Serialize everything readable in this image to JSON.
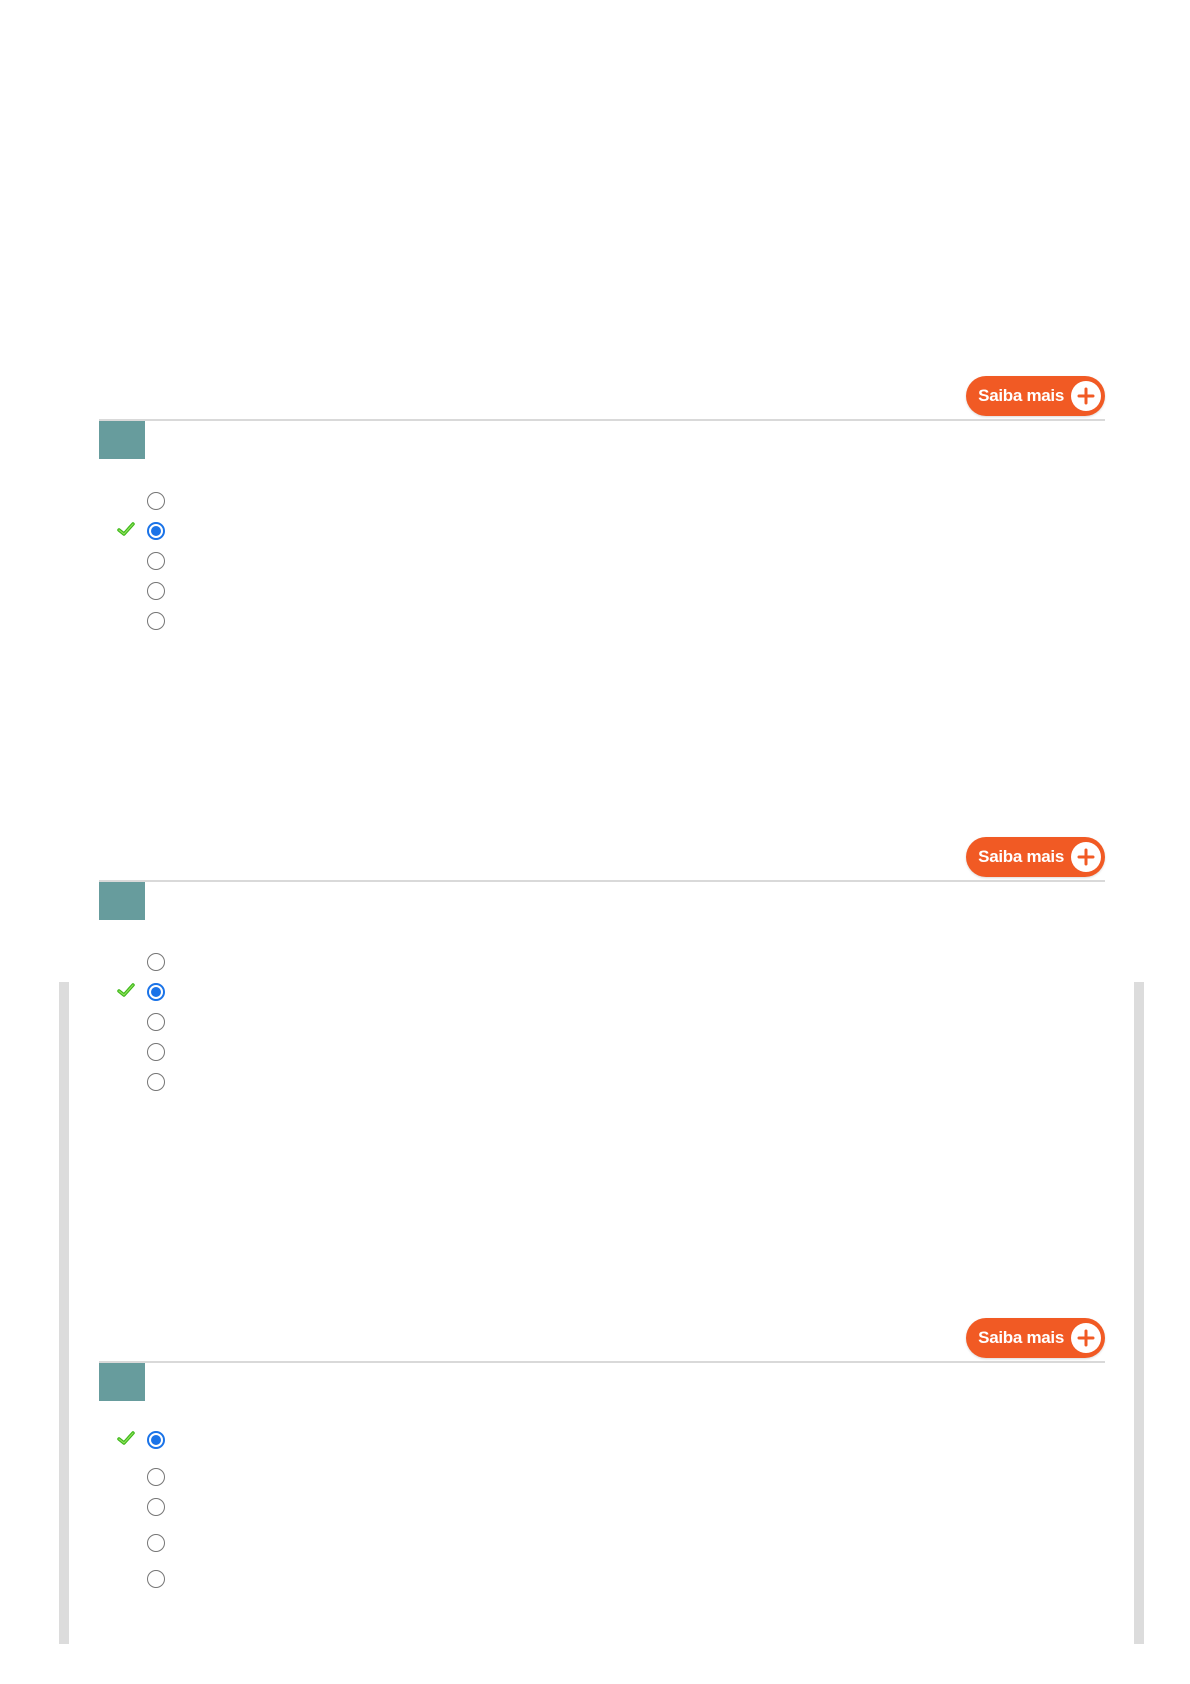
{
  "colors": {
    "accent_orange": "#f15a24",
    "question_badge": "#679c9d",
    "radio_selected": "#1a73e8",
    "correct_check": "#3db81a",
    "side_bar": "#dcdcdc"
  },
  "questions": [
    {
      "saiba_mais_label": "Saiba mais",
      "number": "",
      "options": [
        {
          "text": "",
          "selected": false,
          "correct": false
        },
        {
          "text": "",
          "selected": true,
          "correct": true
        },
        {
          "text": "",
          "selected": false,
          "correct": false
        },
        {
          "text": "",
          "selected": false,
          "correct": false
        },
        {
          "text": "",
          "selected": false,
          "correct": false
        }
      ]
    },
    {
      "saiba_mais_label": "Saiba mais",
      "number": "",
      "options": [
        {
          "text": "",
          "selected": false,
          "correct": false
        },
        {
          "text": "",
          "selected": true,
          "correct": true
        },
        {
          "text": "",
          "selected": false,
          "correct": false
        },
        {
          "text": "",
          "selected": false,
          "correct": false
        },
        {
          "text": "",
          "selected": false,
          "correct": false
        }
      ]
    },
    {
      "saiba_mais_label": "Saiba mais",
      "number": "",
      "options": [
        {
          "text": "",
          "selected": true,
          "correct": true
        },
        {
          "text": "",
          "selected": false,
          "correct": false
        },
        {
          "text": "",
          "selected": false,
          "correct": false
        },
        {
          "text": "",
          "selected": false,
          "correct": false
        },
        {
          "text": "",
          "selected": false,
          "correct": false
        }
      ]
    }
  ]
}
